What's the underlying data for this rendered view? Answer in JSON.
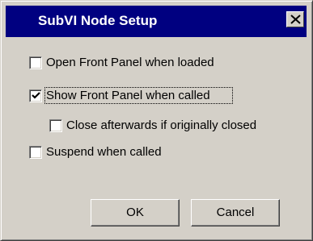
{
  "window": {
    "title": "SubVI Node Setup"
  },
  "options": [
    {
      "label": "Open Front Panel when loaded",
      "checked": false
    },
    {
      "label": "Show Front Panel when called",
      "checked": true
    },
    {
      "label": "Close afterwards if originally closed",
      "checked": false
    },
    {
      "label": "Suspend when called",
      "checked": false
    }
  ],
  "buttons": {
    "ok": "OK",
    "cancel": "Cancel"
  },
  "icons": {
    "close": "close-icon",
    "check": "check-icon"
  },
  "colors": {
    "titlebar": "#000080",
    "face": "#d4d0c8"
  }
}
